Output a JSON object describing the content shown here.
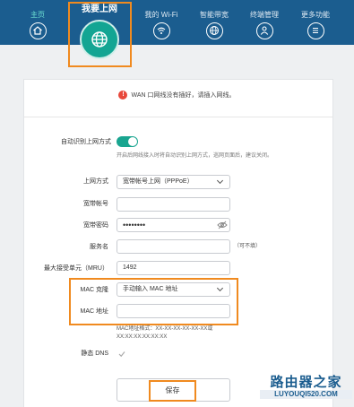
{
  "nav": {
    "home": "主页",
    "featured": "我要上网",
    "items": [
      {
        "label": "我的 Wi-Fi",
        "icon": "wifi-icon"
      },
      {
        "label": "智能带宽",
        "icon": "bandwidth-globe-icon"
      },
      {
        "label": "终端管理",
        "icon": "user-icon"
      },
      {
        "label": "更多功能",
        "icon": "menu-icon"
      }
    ]
  },
  "warning": "WAN 口网线没有插好，请插入网线。",
  "form": {
    "auto_detect": {
      "label": "自动识别上网方式",
      "enabled": true,
      "help": "开启后网线接入时将自动识别上网方式，巡网页面后，建议关闭。"
    },
    "access_type": {
      "label": "上网方式",
      "value": "宽带帐号上网（PPPoE）"
    },
    "account": {
      "label": "宽带帐号",
      "value": ""
    },
    "password": {
      "label": "宽带密码",
      "value": "••••••••"
    },
    "service_name": {
      "label": "服务名",
      "value": "",
      "note": "（可不填）"
    },
    "mru": {
      "label": "最大接受单元（MRU）",
      "value": "1492"
    },
    "mac_clone": {
      "label": "MAC 克隆",
      "value": "手动输入 MAC 地址"
    },
    "mac_address": {
      "label": "MAC 地址",
      "value": "",
      "format_line1": "MAC地址格式：XX-XX-XX-XX-XX-XX或",
      "format_line2": "XX:XX:XX:XX:XX:XX"
    },
    "static_dns": {
      "label": "静态 DNS",
      "checked": true
    }
  },
  "save_label": "保存",
  "watermark": {
    "cn": "路由器之家",
    "en": "LUYOUQI520.COM"
  }
}
